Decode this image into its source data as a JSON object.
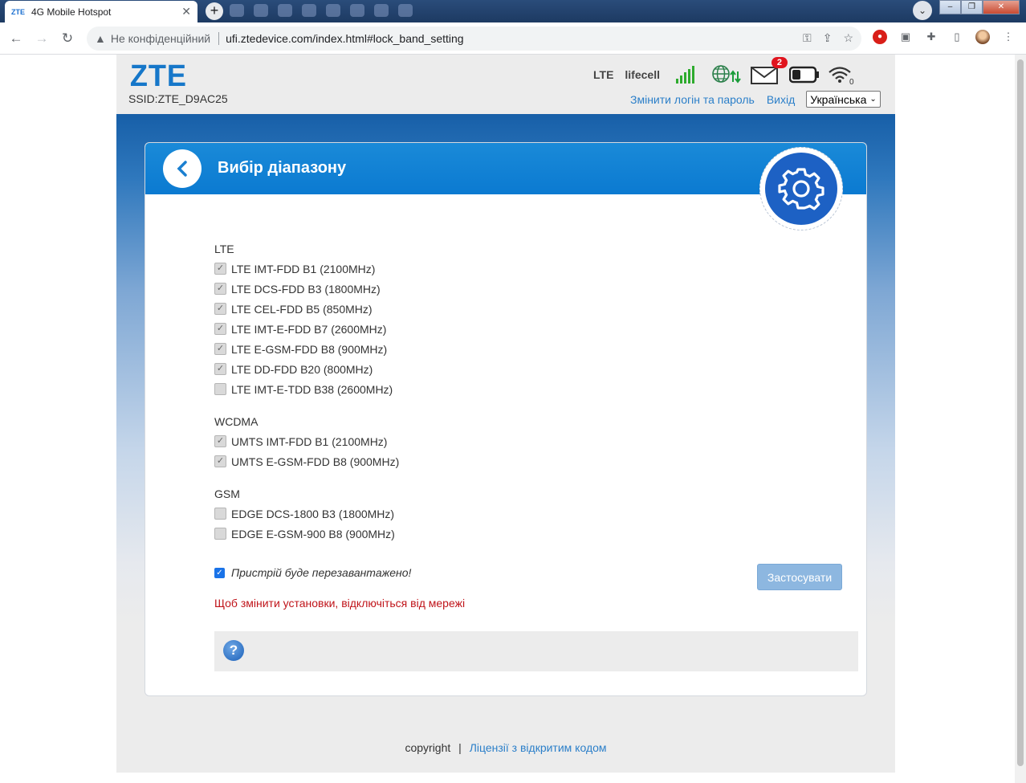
{
  "browser": {
    "tab_favicon": "ZTE",
    "tab_title": "4G Mobile Hotspot",
    "tab_close": "✕",
    "new_tab": "+",
    "insecure_label": "Не конфіденційний",
    "url": "ufi.ztedevice.com/index.html#lock_band_setting"
  },
  "header": {
    "logo": "ZTE",
    "ssid": "SSID:ZTE_D9AC25",
    "network_type": "LTE",
    "operator": "lifecell",
    "unread_messages": "2",
    "wifi_clients": "0",
    "change_login_link": "Змінити логін та пароль",
    "logout_link": "Вихід",
    "language": "Українська"
  },
  "card": {
    "title": "Вибір діапазону"
  },
  "bands": {
    "lte": {
      "title": "LTE",
      "items": [
        {
          "label": "LTE IMT-FDD B1 (2100MHz)",
          "checked": true
        },
        {
          "label": "LTE DCS-FDD B3 (1800MHz)",
          "checked": true
        },
        {
          "label": "LTE CEL-FDD B5 (850MHz)",
          "checked": true
        },
        {
          "label": "LTE IMT-E-FDD B7 (2600MHz)",
          "checked": true
        },
        {
          "label": "LTE E-GSM-FDD B8 (900MHz)",
          "checked": true
        },
        {
          "label": "LTE DD-FDD B20 (800MHz)",
          "checked": true
        },
        {
          "label": "LTE IMT-E-TDD B38 (2600MHz)",
          "checked": false
        }
      ]
    },
    "wcdma": {
      "title": "WCDMA",
      "items": [
        {
          "label": "UMTS IMT-FDD B1 (2100MHz)",
          "checked": true
        },
        {
          "label": "UMTS E-GSM-FDD B8 (900MHz)",
          "checked": true
        }
      ]
    },
    "gsm": {
      "title": "GSM",
      "items": [
        {
          "label": "EDGE DCS-1800 B3 (1800MHz)",
          "checked": false
        },
        {
          "label": "EDGE E-GSM-900 B8 (900MHz)",
          "checked": false
        }
      ]
    }
  },
  "form": {
    "reboot_notice": "Пристрій буде перезавантажено!",
    "reboot_checked": true,
    "apply_label": "Застосувати",
    "disconnect_warning": "Щоб змінити установки, відключіться від мережі"
  },
  "footer": {
    "copyright": "copyright",
    "divider": "|",
    "licenses_link": "Ліцензії з відкритим кодом"
  },
  "colors": {
    "brand_blue": "#1677c9",
    "header_blue": "#0b7ad1",
    "link_blue": "#2b7fc9",
    "warning_red": "#c0141a",
    "signal_green": "#2eab2e",
    "badge_red": "#e0141e"
  }
}
